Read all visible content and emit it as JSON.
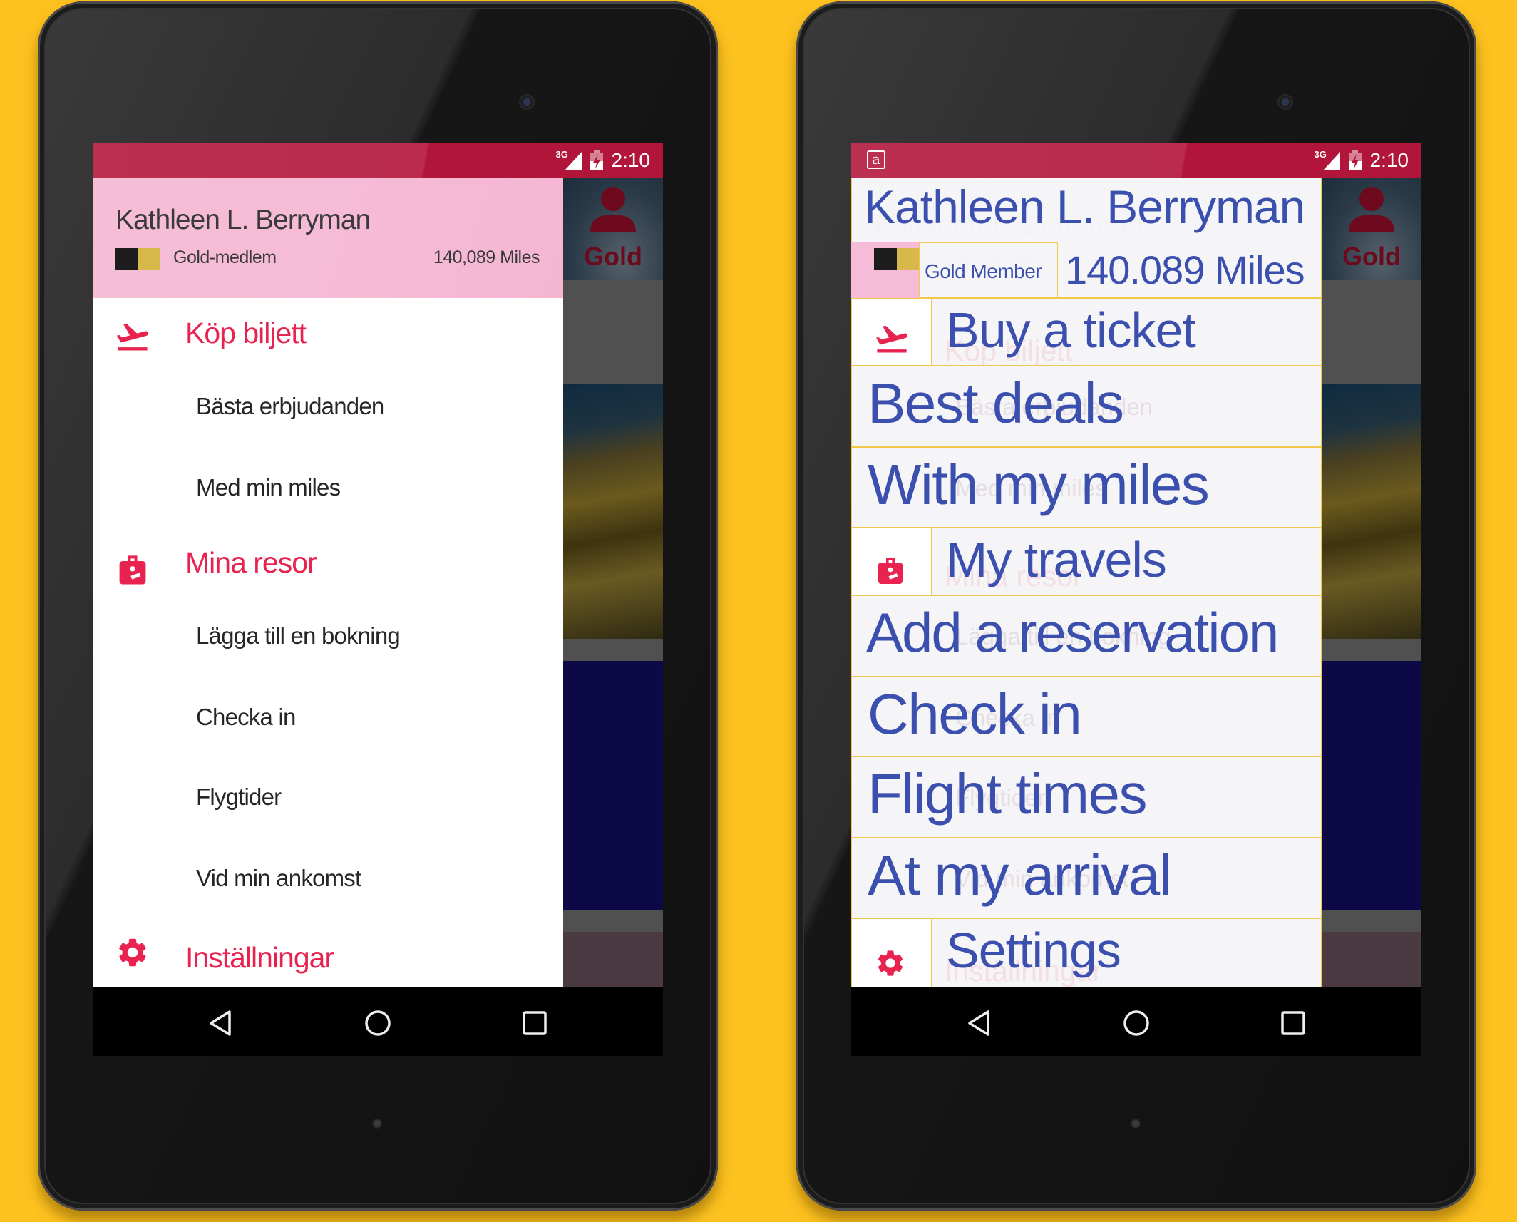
{
  "colors": {
    "background": "#fdc21f",
    "status_bar": "#b1163a",
    "drawer_header": "#f6bbd6",
    "accent_red": "#e8234f",
    "overlay_text_blue": "#3b4fae",
    "overlay_border_gold": "#f1c84a",
    "tier_card_black": "#1c1c1c",
    "tier_card_gold": "#d8b84a"
  },
  "status_bar": {
    "network": "3G",
    "time": "2:10",
    "app_badge": "a"
  },
  "background_app": {
    "profile_icon": "person-icon",
    "tier_badge": "Gold"
  },
  "left_phone": {
    "header": {
      "user_name": "Kathleen L. Berryman",
      "tier": "Gold-medlem",
      "miles": "140,089 Miles"
    },
    "menu": [
      {
        "type": "section",
        "icon": "plane-takeoff-icon",
        "label": "Köp biljett"
      },
      {
        "type": "item",
        "label": "Bästa erbjudanden"
      },
      {
        "type": "item",
        "label": "Med min miles"
      },
      {
        "type": "section",
        "icon": "luggage-icon",
        "label": "Mina resor"
      },
      {
        "type": "item",
        "label": "Lägga till en bokning"
      },
      {
        "type": "item",
        "label": "Checka in"
      },
      {
        "type": "item",
        "label": "Flygtider"
      },
      {
        "type": "item",
        "label": "Vid min ankomst"
      },
      {
        "type": "section",
        "icon": "gear-icon",
        "label": "Inställningar"
      }
    ]
  },
  "right_phone": {
    "header": {
      "user_name": "Kathleen L. Berryman",
      "tier": "Gold Member",
      "miles": "140.089 Miles"
    },
    "menu": [
      {
        "type": "section",
        "icon": "plane-takeoff-icon",
        "label": "Buy a ticket"
      },
      {
        "type": "item",
        "label": "Best deals"
      },
      {
        "type": "item",
        "label": "With my miles"
      },
      {
        "type": "section",
        "icon": "luggage-icon",
        "label": "My travels"
      },
      {
        "type": "item",
        "label": "Add a reservation"
      },
      {
        "type": "item",
        "label": "Check in"
      },
      {
        "type": "item",
        "label": "Flight times"
      },
      {
        "type": "item",
        "label": "At my arrival"
      },
      {
        "type": "section",
        "icon": "gear-icon",
        "label": "Settings"
      }
    ]
  },
  "nav_bar": {
    "back": "back-icon",
    "home": "home-icon",
    "recents": "recents-icon"
  }
}
